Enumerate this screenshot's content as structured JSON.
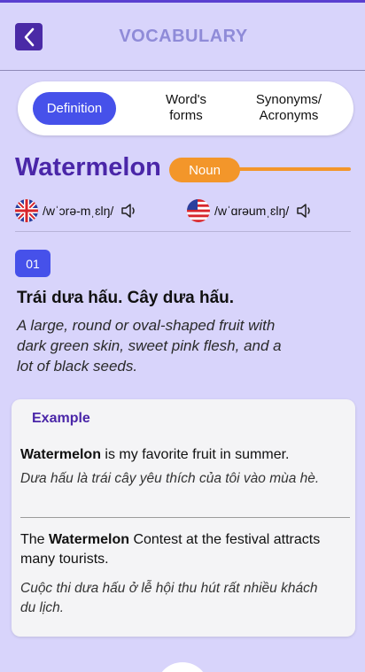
{
  "header": {
    "title": "VOCABULARY"
  },
  "tabs": {
    "definition": "Definition",
    "forms_line1": "Word's",
    "forms_line2": "forms",
    "synonyms_line1": "Synonyms/",
    "synonyms_line2": "Acronyms"
  },
  "word": {
    "text": "Watermelon",
    "part_of_speech": "Noun",
    "uk_ipa": "/wˈɔrə-mˌɛlŋ/",
    "us_ipa": "/wˈɑrəumˌɛlŋ/"
  },
  "definition": {
    "number": "01",
    "meaning_vi": "Trái dưa hấu. Cây dưa hấu.",
    "meaning_en": "A large, round or oval-shaped fruit with dark green skin, sweet pink flesh, and a lot of black seeds."
  },
  "example": {
    "title": "Example",
    "ex1_bold": "Watermelon",
    "ex1_rest": " is my favorite fruit in summer.",
    "ex1_vi": "Dưa hấu là trái cây yêu thích của tôi vào mùa hè.",
    "ex2_pre": "The ",
    "ex2_bold": "Watermelon",
    "ex2_rest": " Contest at the festival attracts many tourists.",
    "ex2_vi": "Cuộc thi dưa hấu ở lễ hội thu hút rất nhiều khách du lịch."
  },
  "colors": {
    "accent": "#4651ea",
    "brand_purple": "#4a26a8",
    "pos_orange": "#f3962a",
    "background": "#d8d4fb"
  }
}
